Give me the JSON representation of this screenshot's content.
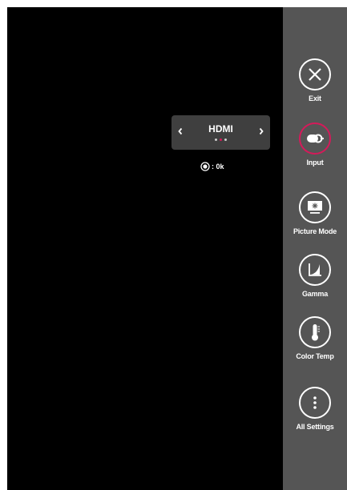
{
  "input_popup": {
    "current_input": "HDMI",
    "left_arrow_icon": "chevron-left-icon",
    "right_arrow_icon": "chevron-right-icon",
    "page_dots": 3,
    "active_dot": 2
  },
  "status": {
    "icon": "radio-target-icon",
    "text": ": 0k"
  },
  "sidebar": {
    "items": [
      {
        "label": "Exit",
        "icon": "close-icon",
        "active": false
      },
      {
        "label": "Input",
        "icon": "input-icon",
        "active": true
      },
      {
        "label": "Picture Mode",
        "icon": "picture-mode-icon",
        "active": false
      },
      {
        "label": "Gamma",
        "icon": "gamma-icon",
        "active": false
      },
      {
        "label": "Color Temp",
        "icon": "thermometer-icon",
        "active": false
      },
      {
        "label": "All Settings",
        "icon": "more-vertical-icon",
        "active": false
      }
    ]
  },
  "colors": {
    "screen_bg": "#000000",
    "sidebar_bg": "#555555",
    "popup_bg": "#3f3f3f",
    "accent": "#d51a5a"
  }
}
